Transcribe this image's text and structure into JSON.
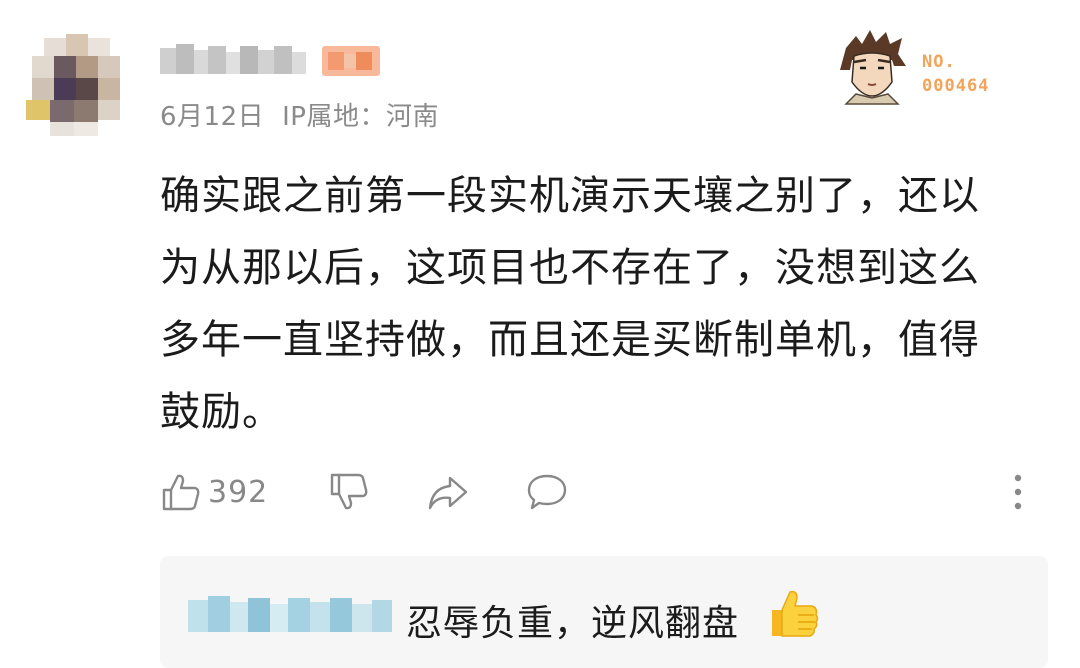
{
  "comment": {
    "date": "6月12日",
    "ip_location": "IP属地：河南",
    "medal": {
      "line1": "NO.",
      "line2": "000464",
      "icon": "character-medal-icon"
    },
    "text": "确实跟之前第一段实机演示天壤之别了，还以为从那以后，这项目也不存在了，没想到这么多年一直坚持做，而且还是买断制单机，值得鼓励。",
    "actions": {
      "like_count": "392",
      "icons": [
        "thumbs-up-icon",
        "thumbs-down-icon",
        "share-icon",
        "comment-icon",
        "more-icon"
      ]
    }
  },
  "reply": {
    "text": "忍辱负重，逆风翻盘",
    "emoji": "thumbs-up-emoji"
  },
  "colors": {
    "meta_gray": "#8a8a8a",
    "medal_orange": "#f2a45a",
    "reply_bg": "#f6f6f6",
    "icon_gray": "#888888"
  }
}
